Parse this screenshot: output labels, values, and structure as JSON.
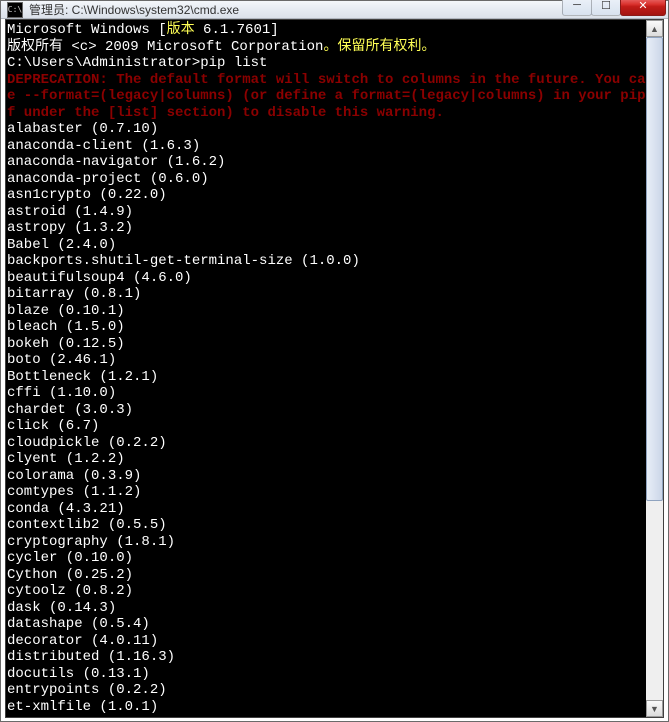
{
  "window": {
    "icon_text": "C:\\",
    "title": "管理员: C:\\Windows\\system32\\cmd.exe"
  },
  "buttons": {
    "min": "─",
    "max": "☐",
    "close": "✕"
  },
  "term": {
    "l1a": "Microsoft Windows [",
    "l1b": "版本",
    "l1c": " 6.1.7601]",
    "l2a": "版权所有 <c> 2009 Microsoft Corporation",
    "l2b": "。保留所有权利。",
    "blank0": "",
    "prompt": "C:\\Users\\Administrator>",
    "cmd": "pip list",
    "dep1": "DEPRECATION: The default format will switch to columns in the future. You can us",
    "dep2": "e --format=(legacy|columns) (or define a format=(legacy|columns) in your pip.con",
    "dep3": "f under the [list] section) to disable this warning.",
    "pkgs": [
      "alabaster (0.7.10)",
      "anaconda-client (1.6.3)",
      "anaconda-navigator (1.6.2)",
      "anaconda-project (0.6.0)",
      "asn1crypto (0.22.0)",
      "astroid (1.4.9)",
      "astropy (1.3.2)",
      "Babel (2.4.0)",
      "backports.shutil-get-terminal-size (1.0.0)",
      "beautifulsoup4 (4.6.0)",
      "bitarray (0.8.1)",
      "blaze (0.10.1)",
      "bleach (1.5.0)",
      "bokeh (0.12.5)",
      "boto (2.46.1)",
      "Bottleneck (1.2.1)",
      "cffi (1.10.0)",
      "chardet (3.0.3)",
      "click (6.7)",
      "cloudpickle (0.2.2)",
      "clyent (1.2.2)",
      "colorama (0.3.9)",
      "comtypes (1.1.2)",
      "conda (4.3.21)",
      "contextlib2 (0.5.5)",
      "cryptography (1.8.1)",
      "cycler (0.10.0)",
      "Cython (0.25.2)",
      "cytoolz (0.8.2)",
      "dask (0.14.3)",
      "datashape (0.5.4)",
      "decorator (4.0.11)",
      "distributed (1.16.3)",
      "docutils (0.13.1)",
      "entrypoints (0.2.2)",
      "et-xmlfile (1.0.1)"
    ]
  }
}
